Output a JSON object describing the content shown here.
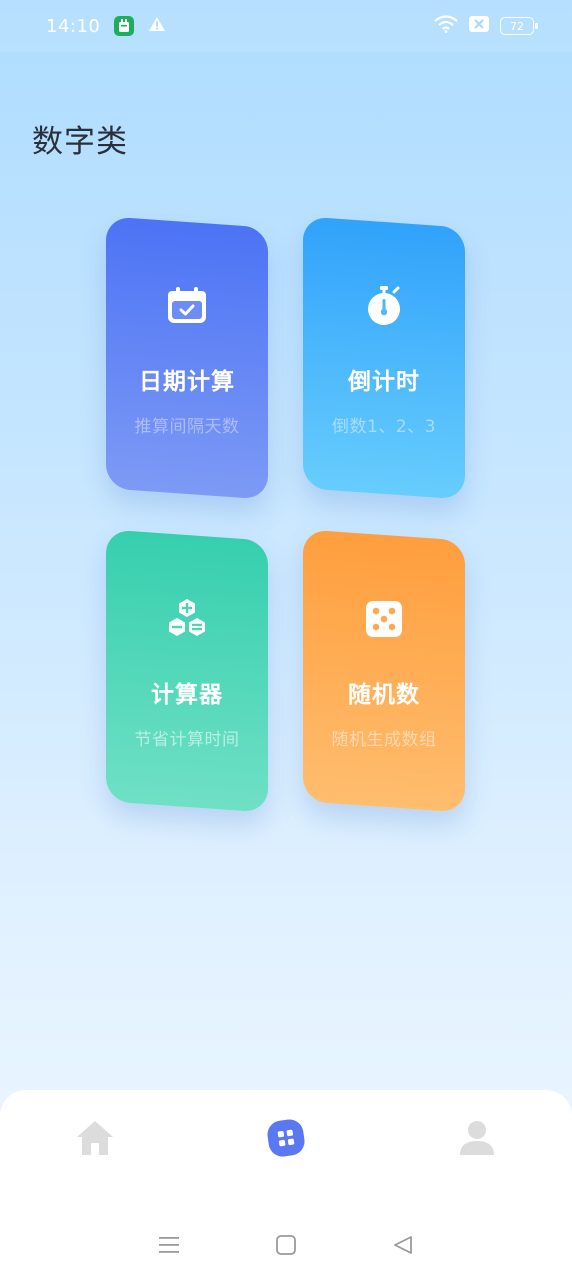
{
  "status_bar": {
    "time": "14:10",
    "battery": "72",
    "icons": [
      "app-notification-icon",
      "warning-icon",
      "wifi-icon",
      "sim-blocked-icon",
      "battery-icon"
    ]
  },
  "page": {
    "title": "数字类"
  },
  "cards": [
    {
      "title": "日期计算",
      "subtitle": "推算间隔天数",
      "icon": "calendar-check-icon",
      "color": "#4c73f5"
    },
    {
      "title": "倒计时",
      "subtitle": "倒数1、2、3",
      "icon": "stopwatch-icon",
      "color": "#31a2fb"
    },
    {
      "title": "计算器",
      "subtitle": "节省计算时间",
      "icon": "calculator-icon",
      "color": "#36cfae"
    },
    {
      "title": "随机数",
      "subtitle": "随机生成数组",
      "icon": "dice-icon",
      "color": "#ff9e3d"
    }
  ],
  "tabs": [
    {
      "name": "home",
      "icon": "home-icon",
      "active": false
    },
    {
      "name": "tools",
      "icon": "apps-icon",
      "active": true
    },
    {
      "name": "profile",
      "icon": "user-icon",
      "active": false
    }
  ],
  "colors": {
    "active_tab": "#5b78f3",
    "inactive_tab": "#dcdcdc"
  }
}
